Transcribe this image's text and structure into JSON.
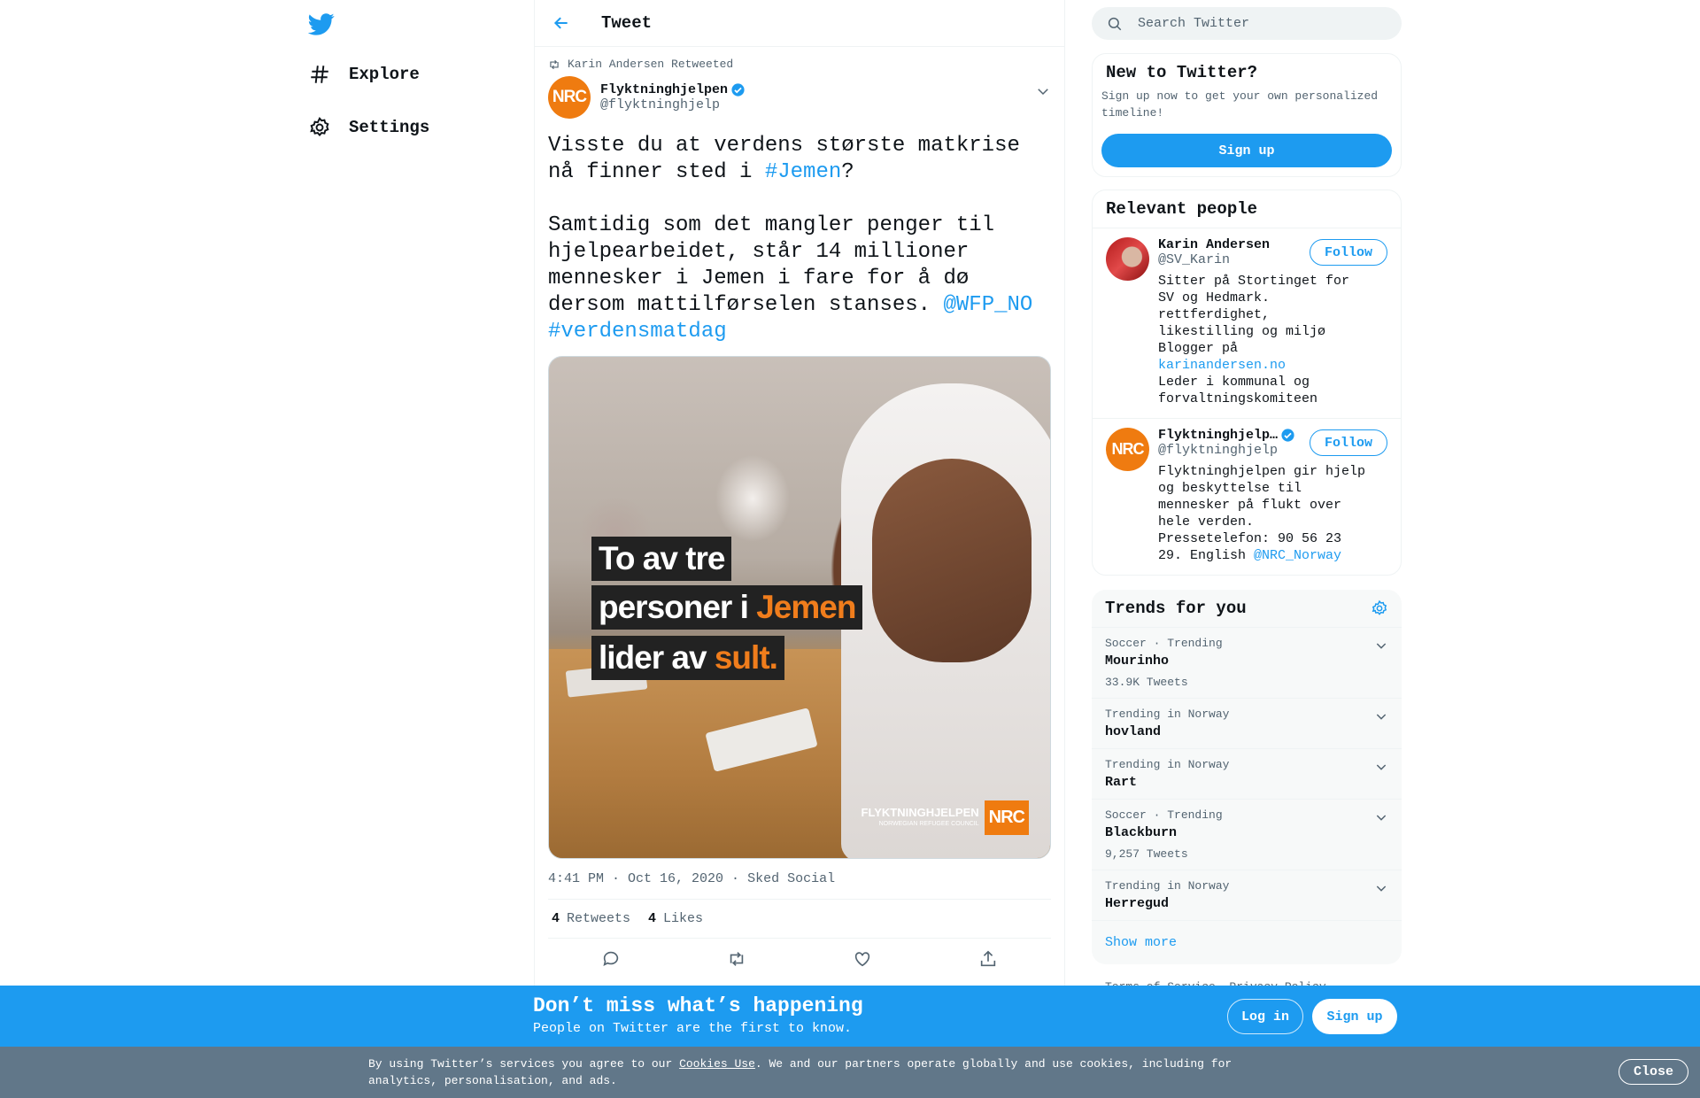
{
  "nav": {
    "logo_icon": "twitter-bird-icon",
    "items": [
      {
        "label": "Explore",
        "icon": "hashtag-icon"
      },
      {
        "label": "Settings",
        "icon": "gear-icon"
      }
    ]
  },
  "header": {
    "title": "Tweet"
  },
  "tweet": {
    "retweeted_by": "Karin Andersen Retweeted",
    "author_name": "Flyktninghjelpen",
    "author_handle": "@flyktninghjelp",
    "avatar_text": "NRC",
    "text_part1": "Visste du at verdens største matkrise nå finner sted i ",
    "hashtag1": "#Jemen",
    "text_part2": "?\n\nSamtidig som det mangler penger til hjelpearbeidet, står 14 millioner mennesker i Jemen i fare for å dø dersom mattilførselen stanses. ",
    "mention": "@WFP_NO",
    "hashtag2": "#verdensmatdag",
    "image": {
      "line1": "To av tre",
      "line2_a": "personer i ",
      "line2_b": "Jemen",
      "line3_a": "lider av ",
      "line3_b": "sult.",
      "brand_name": "FLYKTNINGHJELPEN",
      "brand_sub": "NORWEGIAN REFUGEE COUNCIL",
      "brand_box": "NRC"
    },
    "timestamp": "4:41 PM · Oct 16, 2020",
    "source": "Sked Social",
    "retweets_count": "4",
    "retweets_label": "Retweets",
    "likes_count": "4",
    "likes_label": "Likes"
  },
  "sidebar": {
    "search_placeholder": "Search Twitter",
    "new_title": "New to Twitter?",
    "new_sub": "Sign up now to get your own personalized timeline!",
    "signup_label": "Sign up",
    "relevant_title": "Relevant people",
    "people": [
      {
        "name": "Karin Andersen",
        "handle": "@SV_Karin",
        "bio": "Sitter på Stortinget for SV og Hedmark. rettferdighet, likestilling og miljø Blogger på ",
        "bio_link": "karinandersen.no",
        "bio_end": "\nLeder i kommunal og forvaltningskomiteen",
        "follow": "Follow"
      },
      {
        "name": "Flyktninghjelp…",
        "handle": "@flyktninghjelp",
        "avatar_text": "NRC",
        "bio": "Flyktninghjelpen gir hjelp og beskyttelse til mennesker på flukt over hele verden. Pressetelefon: 90 56 23 29. English ",
        "bio_link": "@NRC_Norway",
        "follow": "Follow"
      }
    ],
    "trends_title": "Trends for you",
    "trends": [
      {
        "context": "Soccer · Trending",
        "name": "Mourinho",
        "count": "33.9K Tweets"
      },
      {
        "context": "Trending in Norway",
        "name": "hovland",
        "count": ""
      },
      {
        "context": "Trending in Norway",
        "name": "Rart",
        "count": ""
      },
      {
        "context": "Soccer · Trending",
        "name": "Blackburn",
        "count": "9,257 Tweets"
      },
      {
        "context": "Trending in Norway",
        "name": "Herregud",
        "count": ""
      }
    ],
    "show_more": "Show more",
    "footer": "Terms of Service  Privacy Policy"
  },
  "bottom_bar": {
    "title": "Don’t miss what’s happening",
    "subtitle": "People on Twitter are the first to know.",
    "login": "Log in",
    "signup": "Sign up"
  },
  "cookie_bar": {
    "text_before": "By using Twitter’s services you agree to our ",
    "link": "Cookies Use",
    "text_after": ". We and our partners operate globally and use cookies, including for analytics, personalisation, and ads.",
    "close": "Close"
  },
  "colors": {
    "accent": "#1d9bf0",
    "nrc_orange": "#ef7b10",
    "cookie_bg": "#617789"
  }
}
